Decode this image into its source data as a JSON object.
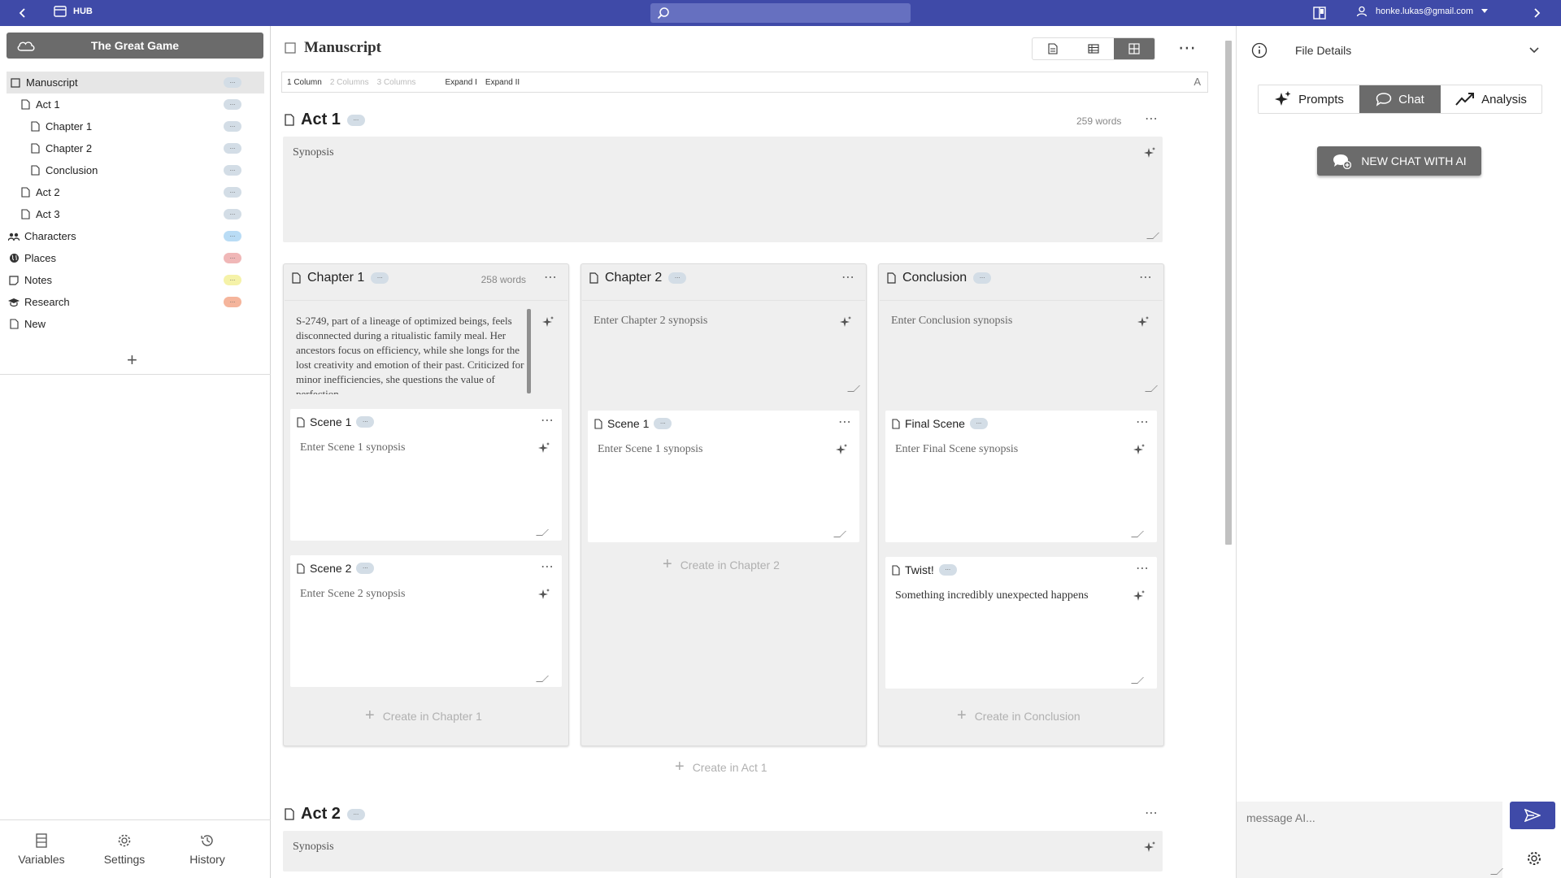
{
  "topbar": {
    "hub_label": "HUB",
    "user_email": "honke.lukas@gmail.com"
  },
  "sidebar": {
    "project_title": "The Great Game",
    "tree": [
      {
        "label": "Manuscript",
        "indent": 0,
        "icon": "manuscript-icon",
        "pill_color": "#d3dde6",
        "active": true
      },
      {
        "label": "Act 1",
        "indent": 1,
        "icon": "document-icon",
        "pill_color": "#d3dde6"
      },
      {
        "label": "Chapter 1",
        "indent": 2,
        "icon": "document-icon",
        "pill_color": "#d3dde6"
      },
      {
        "label": "Chapter 2",
        "indent": 2,
        "icon": "document-icon",
        "pill_color": "#d3dde6"
      },
      {
        "label": "Conclusion",
        "indent": 2,
        "icon": "document-icon",
        "pill_color": "#d3dde6"
      },
      {
        "label": "Act 2",
        "indent": 1,
        "icon": "document-icon",
        "pill_color": "#d3dde6"
      },
      {
        "label": "Act 3",
        "indent": 1,
        "icon": "document-icon",
        "pill_color": "#d3dde6"
      },
      {
        "label": "Characters",
        "indent": 0,
        "icon": "people-icon",
        "pill_color": "#b9dcf5"
      },
      {
        "label": "Places",
        "indent": 0,
        "icon": "globe-icon",
        "pill_color": "#f0b7b7"
      },
      {
        "label": "Notes",
        "indent": 0,
        "icon": "note-icon",
        "pill_color": "#f5f2a8"
      },
      {
        "label": "Research",
        "indent": 0,
        "icon": "graduation-cap-icon",
        "pill_color": "#f5b59c"
      },
      {
        "label": "New",
        "indent": 0,
        "icon": "document-icon",
        "pill_color": null
      }
    ],
    "pill_text": "...",
    "bottom_nav": [
      {
        "label": "Variables",
        "icon": "variables-icon"
      },
      {
        "label": "Settings",
        "icon": "gear-icon"
      },
      {
        "label": "History",
        "icon": "history-icon"
      }
    ]
  },
  "main": {
    "title": "Manuscript",
    "options": {
      "one_column": "1 Column",
      "two_columns": "2 Columns",
      "three_columns": "3 Columns",
      "expand_1": "Expand I",
      "expand_2": "Expand II",
      "font_icon": "A"
    },
    "act1": {
      "title": "Act 1",
      "words": "259 words",
      "synopsis_placeholder": "Synopsis"
    },
    "chapters": [
      {
        "title": "Chapter 1",
        "words": "258 words",
        "synopsis": "S-2749, part of a lineage of optimized beings, feels disconnected during a ritualistic family meal. Her ancestors focus on efficiency, while she longs for the lost creativity and emotion of their past. Criticized for minor inefficiencies, she questions the value of perfection.",
        "scenes": [
          {
            "title": "Scene 1",
            "synopsis": "Enter Scene 1 synopsis"
          },
          {
            "title": "Scene 2",
            "synopsis": "Enter Scene 2 synopsis"
          }
        ],
        "create_label": "Create in Chapter 1"
      },
      {
        "title": "Chapter 2",
        "words": "",
        "synopsis": "Enter Chapter 2 synopsis",
        "scenes": [
          {
            "title": "Scene 1",
            "synopsis": "Enter Scene 1 synopsis"
          }
        ],
        "create_label": "Create in Chapter 2"
      },
      {
        "title": "Conclusion",
        "words": "",
        "synopsis": "Enter Conclusion synopsis",
        "scenes": [
          {
            "title": "Final Scene",
            "synopsis": "Enter Final Scene synopsis"
          },
          {
            "title": "Twist!",
            "synopsis": "Something incredibly unexpected happens"
          }
        ],
        "create_label": "Create in Conclusion"
      }
    ],
    "create_in_act1": "Create in Act 1",
    "act2": {
      "title": "Act 2",
      "synopsis_placeholder": "Synopsis"
    }
  },
  "right_panel": {
    "file_details": "File Details",
    "tabs": [
      {
        "label": "Prompts",
        "icon": "sparkle-icon",
        "active": false
      },
      {
        "label": "Chat",
        "icon": "chat-bubble-icon",
        "active": true
      },
      {
        "label": "Analysis",
        "icon": "trend-icon",
        "active": false
      }
    ],
    "new_chat_button": "NEW CHAT WITH AI",
    "message_placeholder": "message AI..."
  },
  "colors": {
    "accent": "#3f4aa8",
    "dark_button": "#6b6b6b",
    "panel_bg": "#efefef"
  }
}
